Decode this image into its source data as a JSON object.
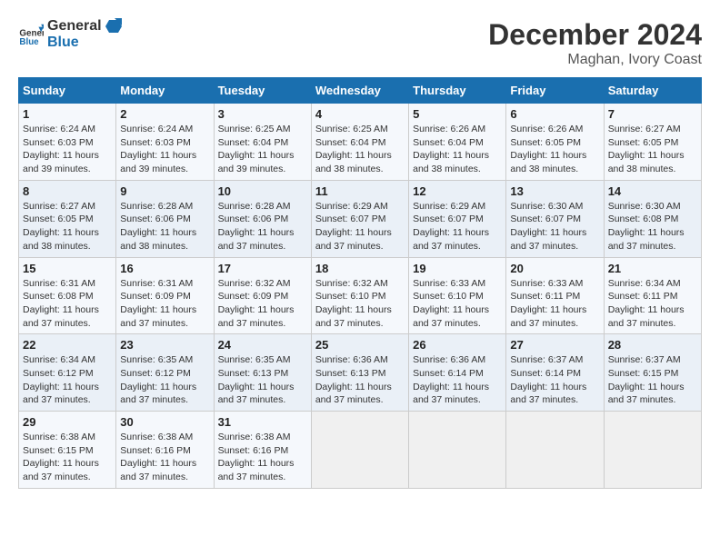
{
  "header": {
    "logo_line1": "General",
    "logo_line2": "Blue",
    "month": "December 2024",
    "location": "Maghan, Ivory Coast"
  },
  "days_of_week": [
    "Sunday",
    "Monday",
    "Tuesday",
    "Wednesday",
    "Thursday",
    "Friday",
    "Saturday"
  ],
  "weeks": [
    [
      {
        "day": "1",
        "rise": "6:24 AM",
        "set": "6:03 PM",
        "daylight": "11 hours and 39 minutes."
      },
      {
        "day": "2",
        "rise": "6:24 AM",
        "set": "6:03 PM",
        "daylight": "11 hours and 39 minutes."
      },
      {
        "day": "3",
        "rise": "6:25 AM",
        "set": "6:04 PM",
        "daylight": "11 hours and 39 minutes."
      },
      {
        "day": "4",
        "rise": "6:25 AM",
        "set": "6:04 PM",
        "daylight": "11 hours and 38 minutes."
      },
      {
        "day": "5",
        "rise": "6:26 AM",
        "set": "6:04 PM",
        "daylight": "11 hours and 38 minutes."
      },
      {
        "day": "6",
        "rise": "6:26 AM",
        "set": "6:05 PM",
        "daylight": "11 hours and 38 minutes."
      },
      {
        "day": "7",
        "rise": "6:27 AM",
        "set": "6:05 PM",
        "daylight": "11 hours and 38 minutes."
      }
    ],
    [
      {
        "day": "8",
        "rise": "6:27 AM",
        "set": "6:05 PM",
        "daylight": "11 hours and 38 minutes."
      },
      {
        "day": "9",
        "rise": "6:28 AM",
        "set": "6:06 PM",
        "daylight": "11 hours and 38 minutes."
      },
      {
        "day": "10",
        "rise": "6:28 AM",
        "set": "6:06 PM",
        "daylight": "11 hours and 37 minutes."
      },
      {
        "day": "11",
        "rise": "6:29 AM",
        "set": "6:07 PM",
        "daylight": "11 hours and 37 minutes."
      },
      {
        "day": "12",
        "rise": "6:29 AM",
        "set": "6:07 PM",
        "daylight": "11 hours and 37 minutes."
      },
      {
        "day": "13",
        "rise": "6:30 AM",
        "set": "6:07 PM",
        "daylight": "11 hours and 37 minutes."
      },
      {
        "day": "14",
        "rise": "6:30 AM",
        "set": "6:08 PM",
        "daylight": "11 hours and 37 minutes."
      }
    ],
    [
      {
        "day": "15",
        "rise": "6:31 AM",
        "set": "6:08 PM",
        "daylight": "11 hours and 37 minutes."
      },
      {
        "day": "16",
        "rise": "6:31 AM",
        "set": "6:09 PM",
        "daylight": "11 hours and 37 minutes."
      },
      {
        "day": "17",
        "rise": "6:32 AM",
        "set": "6:09 PM",
        "daylight": "11 hours and 37 minutes."
      },
      {
        "day": "18",
        "rise": "6:32 AM",
        "set": "6:10 PM",
        "daylight": "11 hours and 37 minutes."
      },
      {
        "day": "19",
        "rise": "6:33 AM",
        "set": "6:10 PM",
        "daylight": "11 hours and 37 minutes."
      },
      {
        "day": "20",
        "rise": "6:33 AM",
        "set": "6:11 PM",
        "daylight": "11 hours and 37 minutes."
      },
      {
        "day": "21",
        "rise": "6:34 AM",
        "set": "6:11 PM",
        "daylight": "11 hours and 37 minutes."
      }
    ],
    [
      {
        "day": "22",
        "rise": "6:34 AM",
        "set": "6:12 PM",
        "daylight": "11 hours and 37 minutes."
      },
      {
        "day": "23",
        "rise": "6:35 AM",
        "set": "6:12 PM",
        "daylight": "11 hours and 37 minutes."
      },
      {
        "day": "24",
        "rise": "6:35 AM",
        "set": "6:13 PM",
        "daylight": "11 hours and 37 minutes."
      },
      {
        "day": "25",
        "rise": "6:36 AM",
        "set": "6:13 PM",
        "daylight": "11 hours and 37 minutes."
      },
      {
        "day": "26",
        "rise": "6:36 AM",
        "set": "6:14 PM",
        "daylight": "11 hours and 37 minutes."
      },
      {
        "day": "27",
        "rise": "6:37 AM",
        "set": "6:14 PM",
        "daylight": "11 hours and 37 minutes."
      },
      {
        "day": "28",
        "rise": "6:37 AM",
        "set": "6:15 PM",
        "daylight": "11 hours and 37 minutes."
      }
    ],
    [
      {
        "day": "29",
        "rise": "6:38 AM",
        "set": "6:15 PM",
        "daylight": "11 hours and 37 minutes."
      },
      {
        "day": "30",
        "rise": "6:38 AM",
        "set": "6:16 PM",
        "daylight": "11 hours and 37 minutes."
      },
      {
        "day": "31",
        "rise": "6:38 AM",
        "set": "6:16 PM",
        "daylight": "11 hours and 37 minutes."
      },
      null,
      null,
      null,
      null
    ]
  ]
}
